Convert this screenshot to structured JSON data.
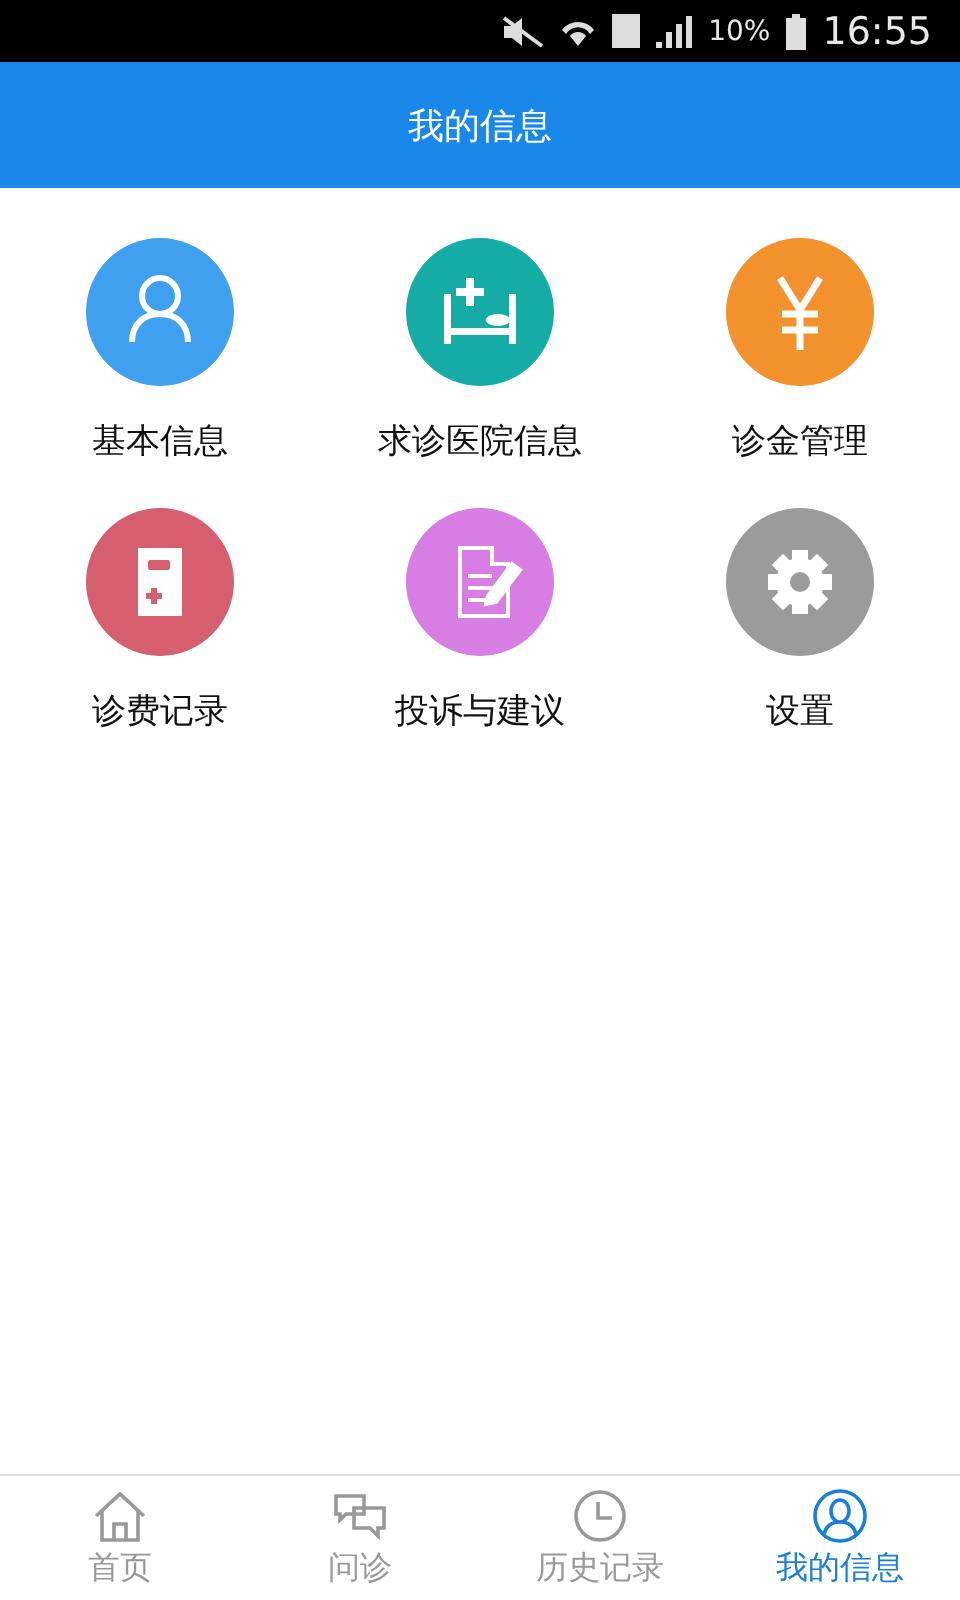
{
  "status_bar": {
    "battery": "10%",
    "time": "16:55"
  },
  "header": {
    "title": "我的信息"
  },
  "menu": [
    {
      "label": "基本信息",
      "kind": "person",
      "color": "#3ea0ee"
    },
    {
      "label": "求诊医院信息",
      "kind": "hospital",
      "color": "#14aca5"
    },
    {
      "label": "诊金管理",
      "kind": "yen",
      "color": "#f3922c"
    },
    {
      "label": "诊费记录",
      "kind": "record",
      "color": "#d55f6e"
    },
    {
      "label": "投诉与建议",
      "kind": "feedback",
      "color": "#d77de4"
    },
    {
      "label": "设置",
      "kind": "settings",
      "color": "#9b9b9b"
    }
  ],
  "tabs": [
    {
      "label": "首页",
      "kind": "home",
      "selected": false
    },
    {
      "label": "问诊",
      "kind": "chat",
      "selected": false
    },
    {
      "label": "历史记录",
      "kind": "history",
      "selected": false
    },
    {
      "label": "我的信息",
      "kind": "profile",
      "selected": true
    }
  ]
}
